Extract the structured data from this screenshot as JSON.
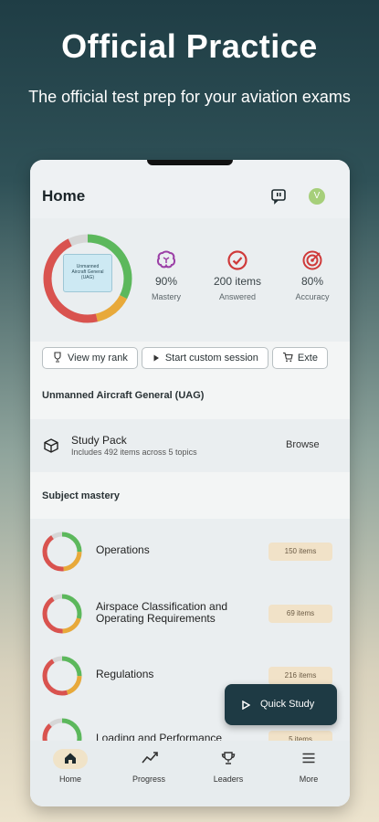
{
  "promo": {
    "title": "Official Practice",
    "subtitle": "The official test prep for your aviation exams"
  },
  "header": {
    "title": "Home",
    "avatar_initial": "V"
  },
  "book_cover": {
    "lines": [
      "Unmanned",
      "Aircraft General",
      "(UAG)"
    ]
  },
  "stats": [
    {
      "value": "90%",
      "label": "Mastery",
      "icon": "brain-icon",
      "color": "#9b3fa6"
    },
    {
      "value": "200 items",
      "label": "Answered",
      "icon": "check-circle-icon",
      "color": "#cf3a3a"
    },
    {
      "value": "80%",
      "label": "Accuracy",
      "icon": "target-icon",
      "color": "#cf3a3a"
    }
  ],
  "chips": [
    {
      "label": "View my rank",
      "icon": "trophy-icon"
    },
    {
      "label": "Start custom session",
      "icon": "play-icon"
    },
    {
      "label": "Exte",
      "icon": "cart-icon"
    }
  ],
  "course_title": "Unmanned Aircraft General (UAG)",
  "study_pack": {
    "name": "Study Pack",
    "description": "Includes 492 items across 5 topics",
    "action": "Browse"
  },
  "subject_mastery_label": "Subject mastery",
  "topics": [
    {
      "name": "Operations",
      "items": "150 items"
    },
    {
      "name": "Airspace Classification and Operating Requirements",
      "items": "69 items"
    },
    {
      "name": "Regulations",
      "items": "216 items"
    },
    {
      "name": "Loading and Performance",
      "items": "5 items"
    }
  ],
  "quick_study_label": "Quick Study",
  "nav": [
    {
      "label": "Home",
      "icon": "home-icon",
      "active": true
    },
    {
      "label": "Progress",
      "icon": "progress-chart-icon"
    },
    {
      "label": "Leaders",
      "icon": "trophy-icon"
    },
    {
      "label": "More",
      "icon": "menu-icon"
    }
  ],
  "colors": {
    "ring_green": "#5cb85c",
    "ring_red": "#d9534f",
    "ring_orange": "#e8a93a",
    "ring_grey": "#d6d6d6",
    "accent_dark": "#1e3a44",
    "badge_bg": "#f1e2c8"
  }
}
